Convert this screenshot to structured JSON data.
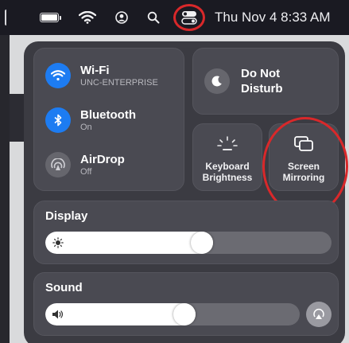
{
  "menubar": {
    "datetime": "Thu Nov 4  8:33 AM",
    "icons": [
      "battery-icon",
      "wifi-icon",
      "user-icon",
      "search-icon",
      "control-center-icon"
    ],
    "highlight_color": "#d9282a"
  },
  "control_center": {
    "network": {
      "wifi": {
        "title": "Wi-Fi",
        "subtitle": "UNC-ENTERPRISE",
        "state": "on"
      },
      "bluetooth": {
        "title": "Bluetooth",
        "subtitle": "On",
        "state": "on"
      },
      "airdrop": {
        "title": "AirDrop",
        "subtitle": "Off",
        "state": "off"
      }
    },
    "do_not_disturb": {
      "label": "Do Not\nDisturb"
    },
    "keyboard_brightness": {
      "label": "Keyboard\nBrightness"
    },
    "screen_mirroring": {
      "label": "Screen\nMirroring"
    },
    "display": {
      "title": "Display",
      "level": 0.55
    },
    "sound": {
      "title": "Sound",
      "level": 0.55
    }
  },
  "colors": {
    "accent_blue": "#1d7cf2",
    "panel": "#3b3b42",
    "tile": "#4a4a52"
  }
}
